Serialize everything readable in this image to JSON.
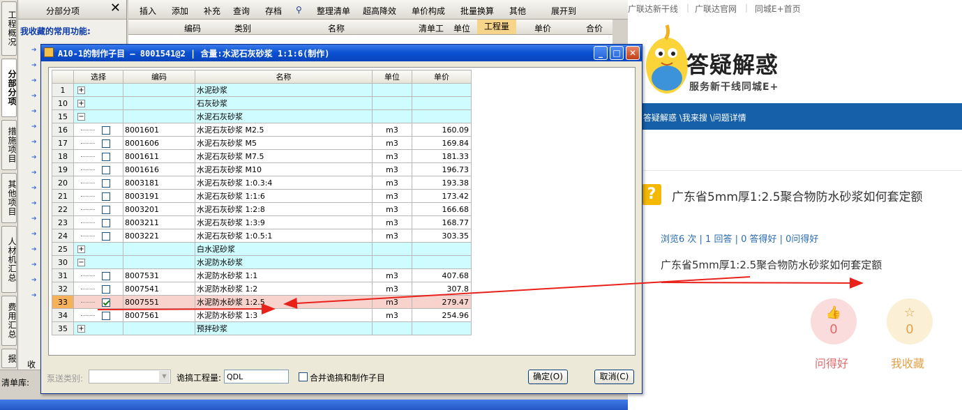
{
  "left_app": {
    "vertical_tabs": [
      "工程概况",
      "分部分项",
      "措施项目",
      "其他项目",
      "人材机汇总",
      "费用汇总",
      "报"
    ],
    "panel": {
      "title": "分部分项",
      "close": "✕",
      "favorites_title": "我收藏的常用功能:",
      "bottom_tab": "收"
    },
    "toolbar": [
      "插入",
      "添加",
      "补充",
      "查询",
      "存档",
      "整理清单",
      "超高降效",
      "单价构成",
      "批量换算",
      "其他",
      "展开到"
    ],
    "grid_headers": [
      "编码",
      "类别",
      "名称",
      "清单工",
      "单位",
      "工程量",
      "单价",
      "合价"
    ],
    "bottom_label": "清单库:"
  },
  "dialog": {
    "title": "A10-1的制作子目 — 8001541@2 | 含量:水泥石灰砂浆 1:1:6(制作)",
    "columns": [
      "选择",
      "编码",
      "名称",
      "单位",
      "单价"
    ],
    "rows": [
      {
        "rn": "1",
        "kind": "group",
        "expand": "+",
        "code": "",
        "name": "水泥砂浆",
        "unit": "",
        "price": ""
      },
      {
        "rn": "10",
        "kind": "group",
        "expand": "+",
        "code": "",
        "name": "石灰砂浆",
        "unit": "",
        "price": ""
      },
      {
        "rn": "15",
        "kind": "group",
        "expand": "−",
        "code": "",
        "name": "水泥石灰砂浆",
        "unit": "",
        "price": ""
      },
      {
        "rn": "16",
        "kind": "item",
        "checked": false,
        "code": "8001601",
        "name": "水泥石灰砂浆 M2.5",
        "unit": "m3",
        "price": "160.09"
      },
      {
        "rn": "17",
        "kind": "item",
        "checked": false,
        "code": "8001606",
        "name": "水泥石灰砂浆 M5",
        "unit": "m3",
        "price": "169.84"
      },
      {
        "rn": "18",
        "kind": "item",
        "checked": false,
        "code": "8001611",
        "name": "水泥石灰砂浆 M7.5",
        "unit": "m3",
        "price": "181.33"
      },
      {
        "rn": "19",
        "kind": "item",
        "checked": false,
        "code": "8001616",
        "name": "水泥石灰砂浆 M10",
        "unit": "m3",
        "price": "196.73"
      },
      {
        "rn": "20",
        "kind": "item",
        "checked": false,
        "code": "8003181",
        "name": "水泥石灰砂浆 1:0.3:4",
        "unit": "m3",
        "price": "193.38"
      },
      {
        "rn": "21",
        "kind": "item",
        "checked": false,
        "code": "8003191",
        "name": "水泥石灰砂浆 1:1:6",
        "unit": "m3",
        "price": "173.42"
      },
      {
        "rn": "22",
        "kind": "item",
        "checked": false,
        "code": "8003201",
        "name": "水泥石灰砂浆 1:2:8",
        "unit": "m3",
        "price": "166.68"
      },
      {
        "rn": "23",
        "kind": "item",
        "checked": false,
        "code": "8003211",
        "name": "水泥石灰砂浆 1:3:9",
        "unit": "m3",
        "price": "168.77"
      },
      {
        "rn": "24",
        "kind": "item",
        "checked": false,
        "code": "8003221",
        "name": "水泥石灰砂浆 1:0.5:1",
        "unit": "m3",
        "price": "303.35"
      },
      {
        "rn": "25",
        "kind": "group",
        "expand": "+",
        "code": "",
        "name": "白水泥砂浆",
        "unit": "",
        "price": ""
      },
      {
        "rn": "30",
        "kind": "group",
        "expand": "−",
        "code": "",
        "name": "水泥防水砂浆",
        "unit": "",
        "price": ""
      },
      {
        "rn": "31",
        "kind": "item",
        "checked": false,
        "code": "8007531",
        "name": "水泥防水砂浆 1:1",
        "unit": "m3",
        "price": "407.68"
      },
      {
        "rn": "32",
        "kind": "item",
        "checked": false,
        "code": "8007541",
        "name": "水泥防水砂浆 1:2",
        "unit": "m3",
        "price": "307.8"
      },
      {
        "rn": "33",
        "kind": "item",
        "checked": true,
        "selected": true,
        "code": "8007551",
        "name": "水泥防水砂浆 1:2.5",
        "unit": "m3",
        "price": "279.47"
      },
      {
        "rn": "34",
        "kind": "item",
        "checked": false,
        "code": "8007561",
        "name": "水泥防水砂浆 1:3",
        "unit": "m3",
        "price": "254.96"
      },
      {
        "rn": "35",
        "kind": "group",
        "expand": "+",
        "code": "",
        "name": "预拌砂浆",
        "unit": "",
        "price": ""
      }
    ],
    "footer": {
      "type_label": "泵送类别:",
      "type_value": "",
      "qty_label": "诡搞工程量:",
      "qty_value": "QDL",
      "merge_label": "合并诡搞和制作子目",
      "ok_label": "确定(O)",
      "cancel_label": "取消(C)"
    }
  },
  "web": {
    "top_links": [
      "广联达新干线",
      "广联达官网",
      "同城E+首页"
    ],
    "brand_title": "答疑解惑",
    "brand_sub": "服务新干线同城E+",
    "breadcrumb": "答疑解惑 \\我来搜 \\问题详情",
    "question_title": "广东省5mm厚1:2.5聚合物防水砂浆如何套定额",
    "stats": "浏览6 次 | 1 回答 | 0 答得好 | 0问得好",
    "question_body": "广东省5mm厚1:2.5聚合物防水砂浆如何套定额",
    "good": {
      "count": "0",
      "label": "问得好"
    },
    "fav": {
      "count": "0",
      "label": "我收藏"
    }
  },
  "colors": {
    "titlebar": "#0a4fd1",
    "group_row": "#cffcff",
    "selected_row": "#f8d2cc",
    "arrow": "#e8211b",
    "web_blue": "#1560a8"
  }
}
